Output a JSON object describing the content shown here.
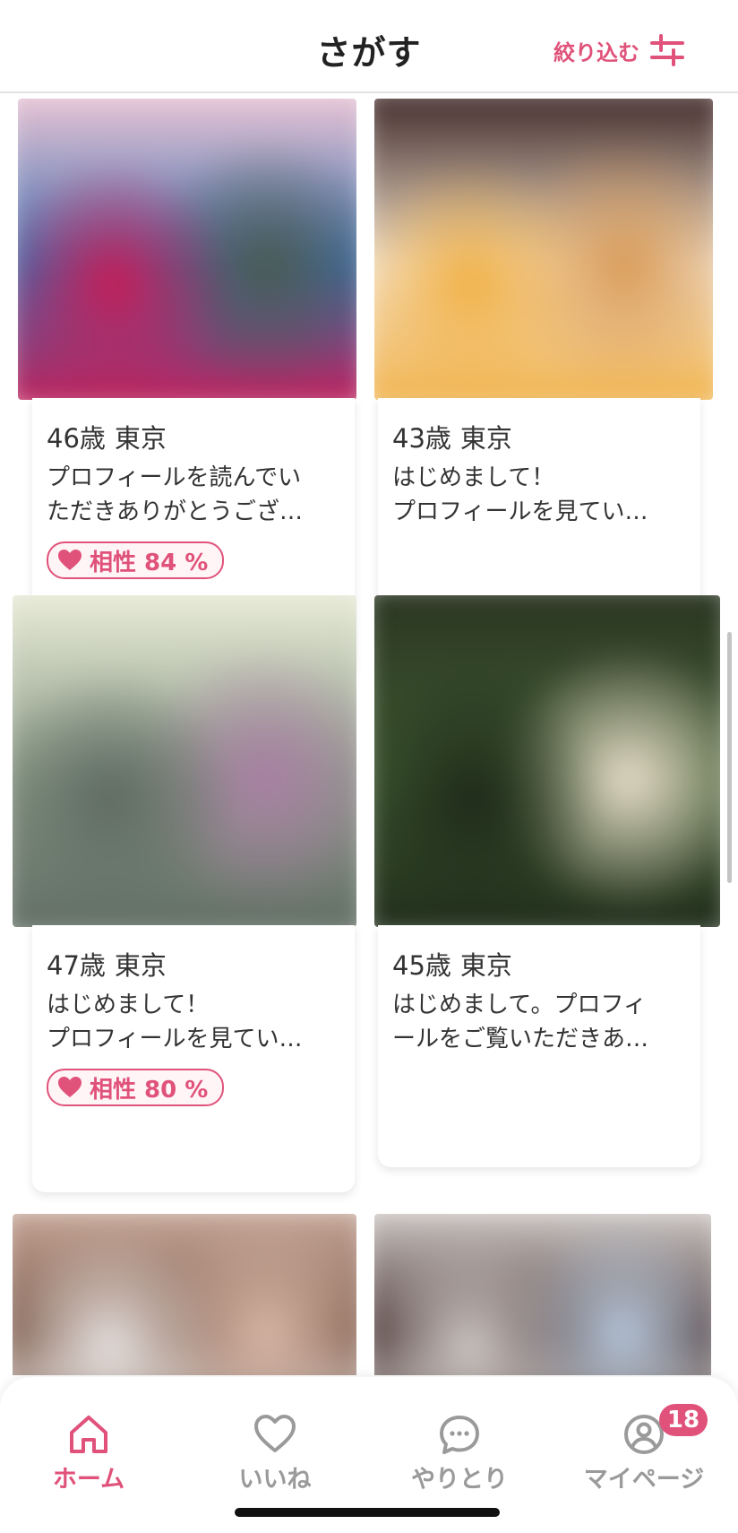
{
  "header": {
    "title": "さがす",
    "filter_label": "絞り込む",
    "filter_icon": "sliders-icon"
  },
  "cards": [
    {
      "age": "46歳",
      "city": "東京",
      "message": "プロフィールを読んでい\nただきありがとうござ…",
      "compatibility": "相性 84 %",
      "photo_colors": [
        "#f2c8d6",
        "#3a6fb0",
        "#c81b55",
        "#4b5a52"
      ]
    },
    {
      "age": "43歳",
      "city": "東京",
      "message": "はじめまして！\nプロフィールを見てい…",
      "compatibility": null,
      "photo_colors": [
        "#3a2323",
        "#f4e6d4",
        "#f1b044",
        "#d99a55"
      ]
    },
    {
      "age": "47歳",
      "city": "東京",
      "message": "はじめまして！\nプロフィールを見てい…",
      "compatibility": "相性 80 %",
      "photo_colors": [
        "#eef0dc",
        "#8a9a86",
        "#5f6b63",
        "#a97fa4"
      ]
    },
    {
      "age": "45歳",
      "city": "東京",
      "message": "はじめまして。プロフィ\nールをご覧いただきあ…",
      "compatibility": null,
      "photo_colors": [
        "#2a3422",
        "#3f5a30",
        "#1e2a1a",
        "#e7ddc9"
      ]
    },
    {
      "photo_colors": [
        "#c8a99a",
        "#7a5848",
        "#e7e2e0",
        "#d9b8a8"
      ]
    },
    {
      "photo_colors": [
        "#d4cfcc",
        "#4a3634",
        "#cfc9c6",
        "#b7c8dc"
      ]
    }
  ],
  "tabs": [
    {
      "label": "ホーム",
      "icon": "home-icon",
      "active": true
    },
    {
      "label": "いいね",
      "icon": "heart-icon",
      "active": false
    },
    {
      "label": "やりとり",
      "icon": "chat-icon",
      "active": false
    },
    {
      "label": "マイページ",
      "icon": "user-icon",
      "active": false,
      "badge": "18"
    }
  ],
  "colors": {
    "accent": "#e0527a",
    "inactive": "#9a9a9a"
  }
}
